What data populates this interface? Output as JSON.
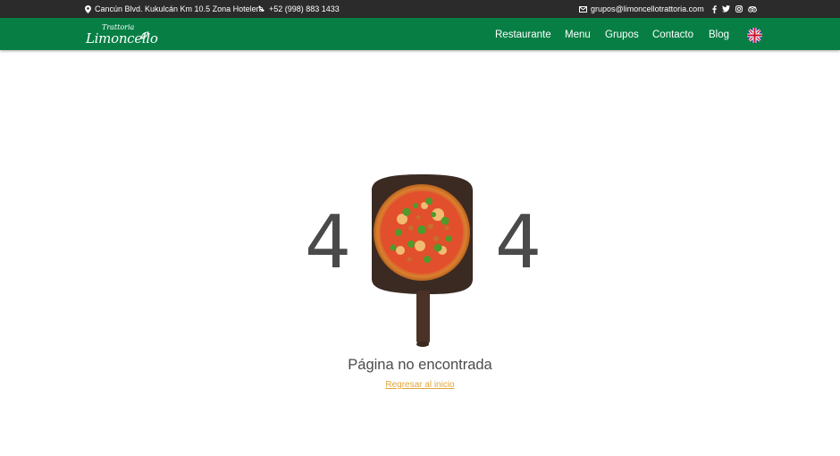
{
  "topbar": {
    "address": "Cancún Blvd. Kukulcán Km 10.5 Zona Hotelera",
    "phone": "+52 (998) 883 1433",
    "email": "grupos@limoncellotrattoria.com",
    "address_icon": "map-marker-icon",
    "phone_icon": "phone-icon",
    "email_icon": "envelope-icon",
    "social": [
      "facebook-icon",
      "twitter-icon",
      "instagram-icon",
      "tripadvisor-icon"
    ]
  },
  "brand": {
    "small_text": "Trattoria",
    "name": "Limoncello"
  },
  "nav": {
    "items": [
      {
        "label": "Restaurante"
      },
      {
        "label": "Menu"
      },
      {
        "label": "Grupos"
      },
      {
        "label": "Contacto"
      },
      {
        "label": "Blog"
      }
    ],
    "language_icon": "uk-flag-icon"
  },
  "error": {
    "left_digit": "4",
    "right_digit": "4",
    "image": "pizza-on-peel",
    "title": "Página no encontrada",
    "link_label": "Regresar al inicio"
  },
  "colors": {
    "topbar_bg": "#2b2b2b",
    "nav_bg": "#077f44",
    "link": "#e0a53a",
    "digit": "#4a4a4a"
  }
}
